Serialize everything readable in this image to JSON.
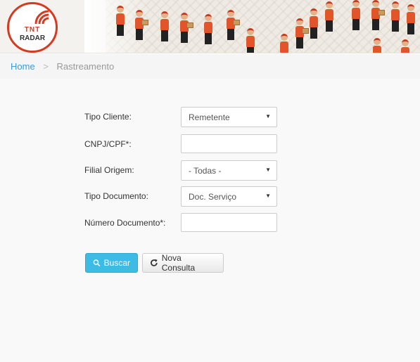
{
  "header": {
    "logo_tnt": "TNT",
    "logo_radar": "RADAR",
    "brand_color": "#d63a20"
  },
  "breadcrumb": {
    "home": "Home",
    "separator": ">",
    "current": "Rastreamento"
  },
  "form": {
    "tipo_cliente_label": "Tipo Cliente:",
    "tipo_cliente_value": "Remetente",
    "cnpj_label": "CNPJ/CPF*:",
    "cnpj_value": "",
    "filial_label": "Filial Origem:",
    "filial_value": "- Todas -",
    "tipo_documento_label": "Tipo Documento:",
    "tipo_documento_value": "Doc. Serviço",
    "numero_documento_label": "Número Documento*:",
    "numero_documento_value": ""
  },
  "buttons": {
    "buscar": "Buscar",
    "nova_consulta": "Nova Consulta"
  },
  "icons": {
    "search": "search-icon",
    "refresh": "refresh-icon",
    "dropdown": "caret-down-icon"
  },
  "colors": {
    "primary_button": "#3dbbe4",
    "link": "#3a9ad9"
  }
}
